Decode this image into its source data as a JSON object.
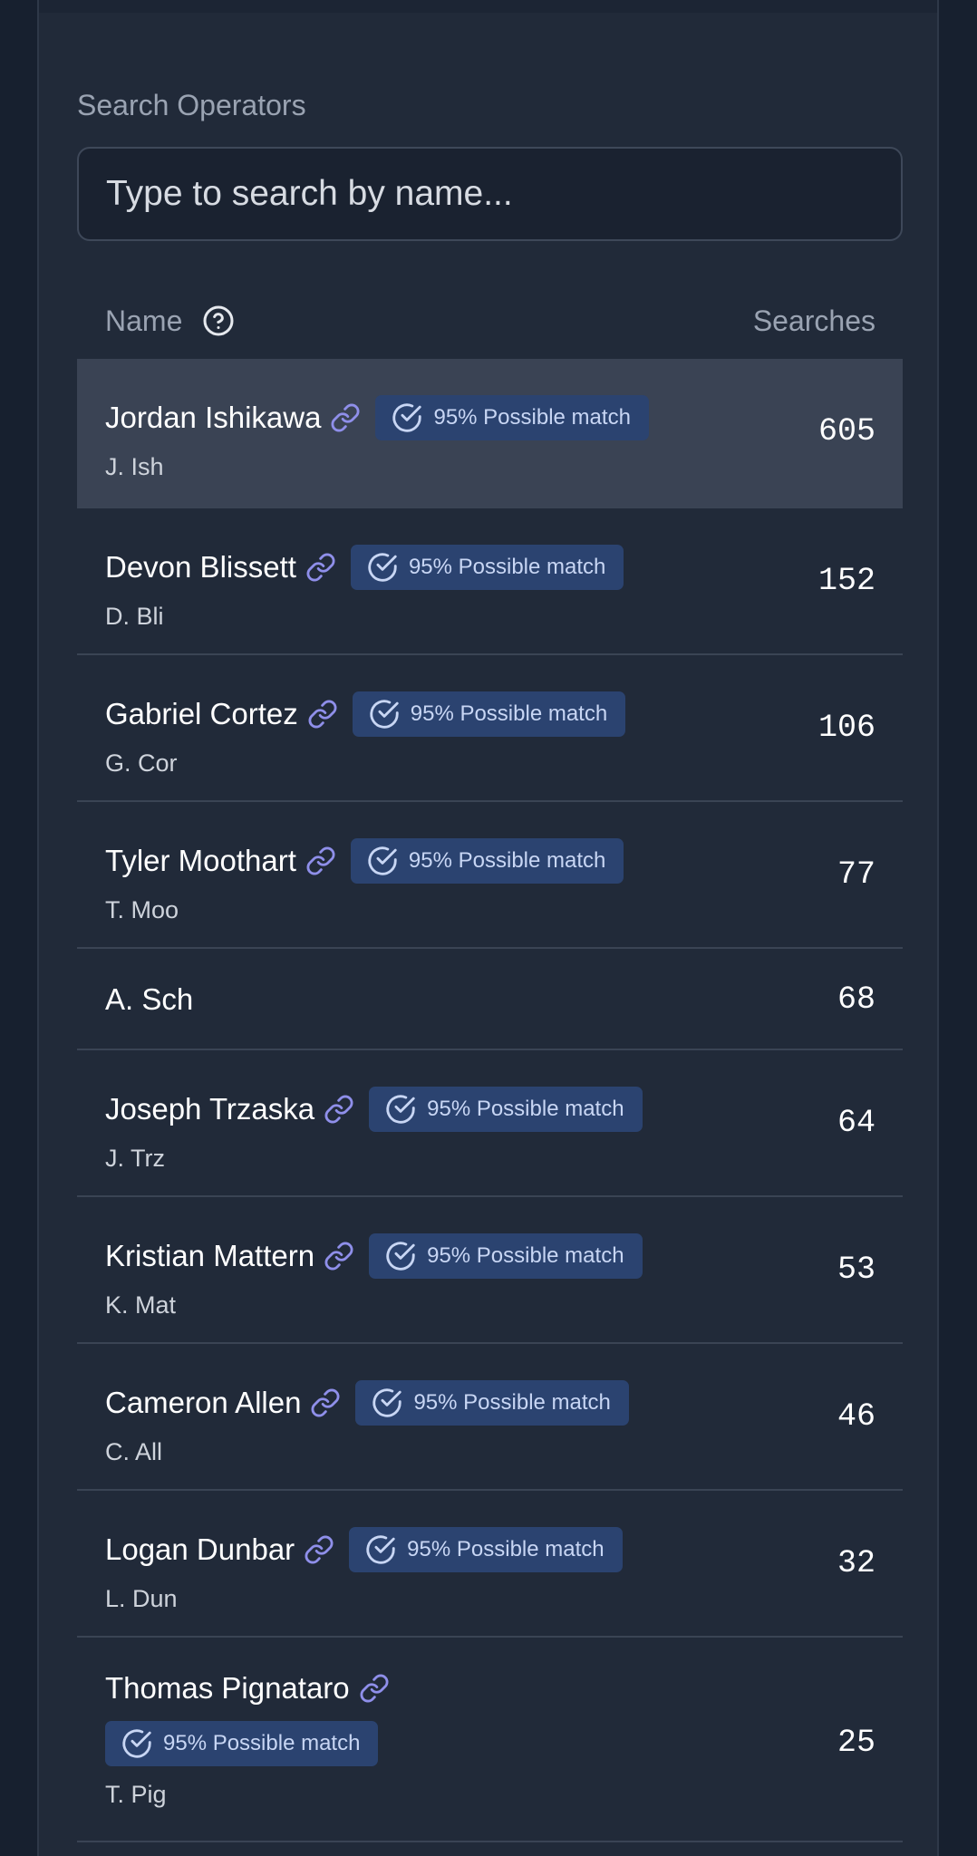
{
  "operators": {
    "title": "Search Operators",
    "search": {
      "placeholder": "Type to search by name...",
      "value": ""
    },
    "columns": {
      "name": "Name",
      "searches": "Searches"
    },
    "badge_label": "95% Possible match",
    "rows": [
      {
        "name": "Jordan Ishikawa",
        "alias": "J. Ish",
        "count": "605",
        "badge": "95% Possible match",
        "highlighted": true
      },
      {
        "name": "Devon Blissett",
        "alias": "D. Bli",
        "count": "152",
        "badge": "95% Possible match"
      },
      {
        "name": "Gabriel Cortez",
        "alias": "G. Cor",
        "count": "106",
        "badge": "95% Possible match"
      },
      {
        "name": "Tyler Moothart",
        "alias": "T. Moo",
        "count": "77",
        "badge": "95% Possible match"
      },
      {
        "name": "",
        "alias": "A. Sch",
        "count": "68",
        "badge": ""
      },
      {
        "name": "Joseph Trzaska",
        "alias": "J. Trz",
        "count": "64",
        "badge": "95% Possible match"
      },
      {
        "name": "Kristian Mattern",
        "alias": "K. Mat",
        "count": "53",
        "badge": "95% Possible match"
      },
      {
        "name": "Cameron Allen",
        "alias": "C. All",
        "count": "46",
        "badge": "95% Possible match"
      },
      {
        "name": "Logan Dunbar",
        "alias": "L. Dun",
        "count": "32",
        "badge": "95% Possible match"
      },
      {
        "name": "Thomas Pignataro",
        "alias": "T. Pig",
        "count": "25",
        "badge": "95% Possible match"
      }
    ]
  },
  "icons": {
    "help": "question-circle-icon",
    "link": "link-icon",
    "badge": "check-circle-icon"
  },
  "colors": {
    "panel_bg": "#212a39",
    "page_bg": "#17202f",
    "highlight_row": "#3a4354",
    "badge_bg": "#2b4370",
    "badge_text": "#c8d6f4",
    "link_icon": "#8f8fea"
  }
}
